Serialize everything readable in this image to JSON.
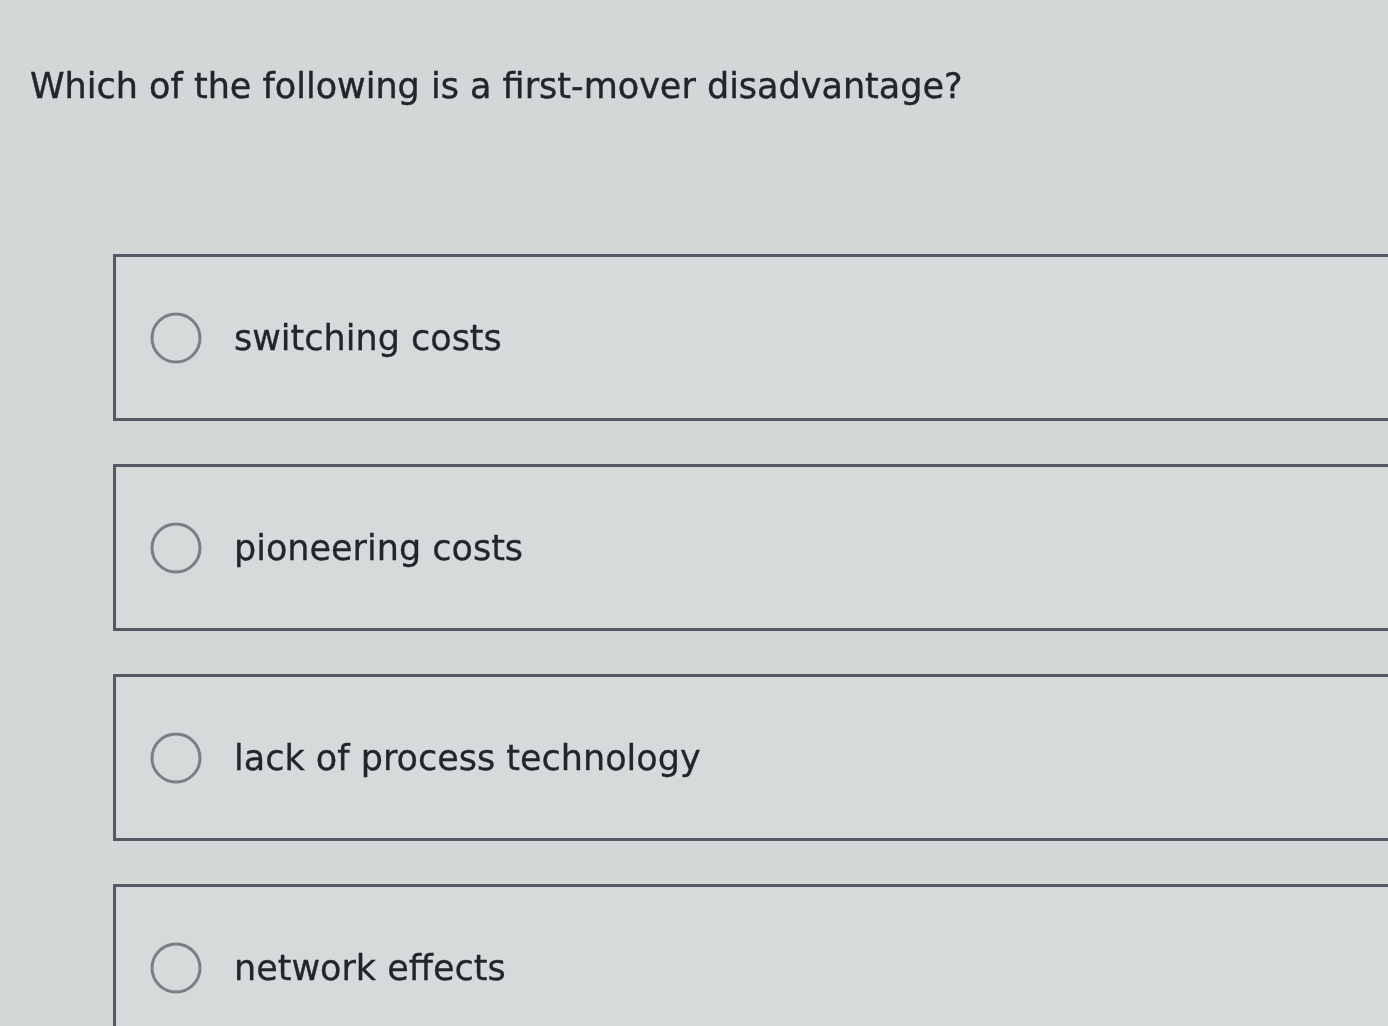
{
  "question": "Which of the following is a first-mover disadvantage?",
  "options": [
    {
      "label": "switching costs",
      "selected": false
    },
    {
      "label": "pioneering costs",
      "selected": false
    },
    {
      "label": "lack of process technology",
      "selected": false
    },
    {
      "label": "network effects",
      "selected": false
    }
  ]
}
